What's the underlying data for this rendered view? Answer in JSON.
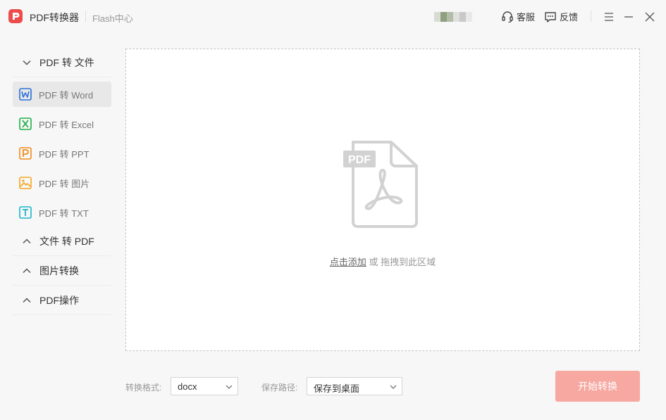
{
  "app": {
    "title": "PDF转换器",
    "flash_link": "Flash中心"
  },
  "titlebar": {
    "support_label": "客服",
    "feedback_label": "反馈"
  },
  "sidebar": {
    "groups": [
      {
        "label": "PDF 转 文件",
        "expanded": true,
        "items": [
          {
            "label": "PDF 转 Word",
            "icon": "word-icon",
            "color": "#2b6fdb",
            "active": true
          },
          {
            "label": "PDF 转 Excel",
            "icon": "excel-icon",
            "color": "#1fad45",
            "active": false
          },
          {
            "label": "PDF 转 PPT",
            "icon": "ppt-icon",
            "color": "#f08c1b",
            "active": false
          },
          {
            "label": "PDF 转 图片",
            "icon": "image-icon",
            "color": "#f5a623",
            "active": false
          },
          {
            "label": "PDF 转 TXT",
            "icon": "txt-icon",
            "color": "#19b5c9",
            "active": false
          }
        ]
      },
      {
        "label": "文件 转 PDF",
        "expanded": false
      },
      {
        "label": "图片转换",
        "expanded": false
      },
      {
        "label": "PDF操作",
        "expanded": false
      }
    ]
  },
  "dropzone": {
    "badge": "PDF",
    "add_link": "点击添加",
    "hint_rest": " 或 拖拽到此区域"
  },
  "bottom": {
    "format_label": "转换格式:",
    "format_value": "docx",
    "path_label": "保存路径:",
    "path_value": "保存到桌面",
    "start_label": "开始转换"
  },
  "colors": {
    "brand": "#ee4b4b",
    "start_button": "#f6a8a1"
  }
}
